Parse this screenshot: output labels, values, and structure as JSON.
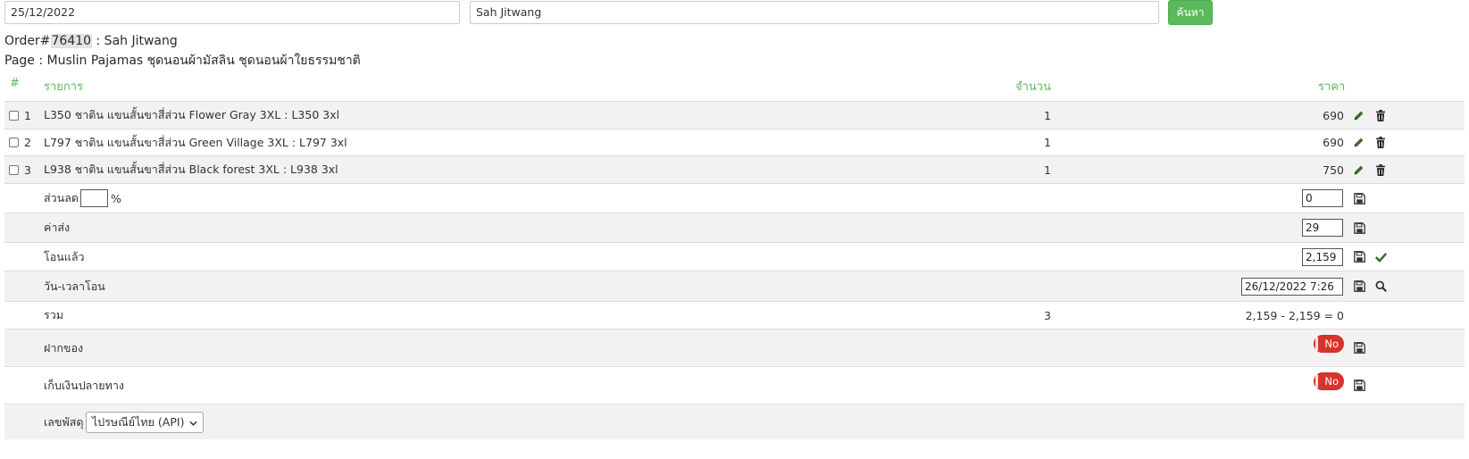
{
  "search": {
    "date_value": "25/12/2022",
    "name_value": "Sah Jitwang",
    "button_label": "ค้นหา"
  },
  "order": {
    "order_prefix": "Order#",
    "order_number": "76410",
    "order_customer": ": Sah Jitwang",
    "page_line": "Page : Muslin Pajamas ชุดนอนผ้ามัสลิน ชุดนอนผ้าใยธรรมชาติ"
  },
  "table": {
    "headers": {
      "index": "#",
      "item": "รายการ",
      "qty": "จำนวน",
      "price": "ราคา"
    },
    "items": [
      {
        "index": "1",
        "name": "L350 ชาติน แขนสั้นขาสี่ส่วน Flower Gray 3XL : L350 3xl",
        "qty": "1",
        "price": "690"
      },
      {
        "index": "2",
        "name": "L797 ชาติน แขนสั้นขาสี่ส่วน Green Village 3XL : L797 3xl",
        "qty": "1",
        "price": "690"
      },
      {
        "index": "3",
        "name": "L938 ชาติน แขนสั้นขาสี่ส่วน Black forest 3XL : L938 3xl",
        "qty": "1",
        "price": "750"
      }
    ]
  },
  "summary": {
    "discount_label": "ส่วนลด",
    "discount_pct_value": "",
    "discount_pct_unit": "%",
    "discount_value": "0",
    "shipping_label": "ค่าส่ง",
    "shipping_value": "29",
    "paid_label": "โอนแล้ว",
    "paid_value": "2,159",
    "paid_datetime_label": "วัน-เวลาโอน",
    "paid_datetime_value": "26/12/2022 7:26",
    "total_label": "รวม",
    "total_qty": "3",
    "total_calc": "2,159 - 2,159 = 0",
    "deposit_label": "ฝากของ",
    "deposit_toggle": "No",
    "cod_label": "เก็บเงินปลายทาง",
    "cod_toggle": "No",
    "tracking_label": "เลขพัสดุ",
    "tracking_carrier": "ไปรษณีย์ไทย (API)"
  },
  "colors": {
    "accent_green": "#5cb85c",
    "toggle_red": "#d9342b",
    "edit_icon": "#3a6e2a"
  }
}
